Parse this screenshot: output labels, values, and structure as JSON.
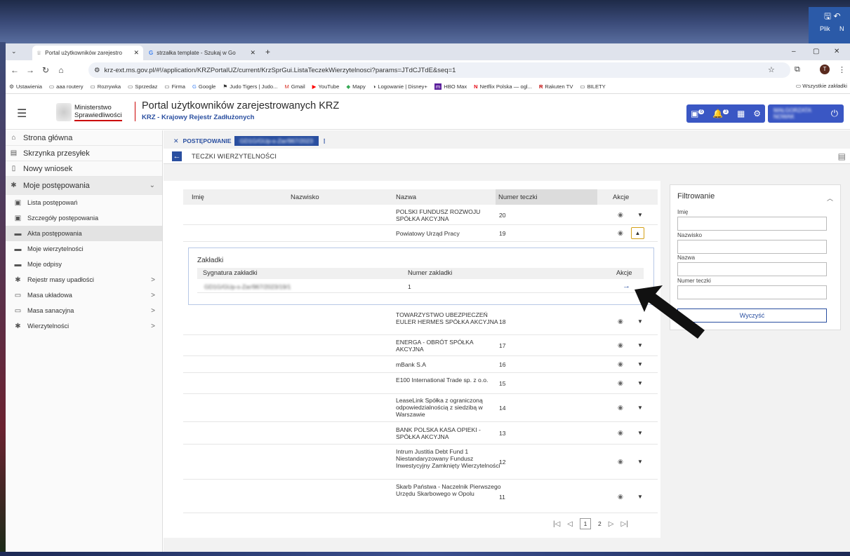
{
  "word": {
    "label_plik": "Plik",
    "label_n": "N"
  },
  "browser": {
    "tabs": [
      {
        "label": "Portal użytkowników zarejestro",
        "close": "✕"
      },
      {
        "label": "strzałka template - Szukaj w Go",
        "close": "✕"
      }
    ],
    "new_tab": "+",
    "url": "krz-ext.ms.gov.pl/#!/application/KRZPortalUZ/current/KrzSprGui.ListaTeczekWierzytelnosci?params=JTdCJTdE&seq=1",
    "window_controls": {
      "min": "–",
      "max": "▢",
      "close": "✕"
    },
    "bookmarks": [
      "Ustawienia",
      "aaa routery",
      "Rozrywka",
      "Sprzedaz",
      "Firma",
      "Google",
      "Judo Tigers | Judo...",
      "Gmail",
      "YouTube",
      "Mapy",
      "Logowanie | Disney+",
      "HBO Max",
      "Netflix Polska — ogl...",
      "Rakuten TV",
      "BILETY"
    ],
    "bookmarks_all": "Wszystkie zakładki",
    "profile_initial": "T"
  },
  "header": {
    "logo_line1": "Ministerstwo",
    "logo_line2": "Sprawiedliwości",
    "title": "Portal użytkowników zarejestrowanych KRZ",
    "subtitle": "KRZ - Krajowy Rejestr Zadłużonych",
    "badge_messages": "6",
    "badge_notifications": "3",
    "user_name": "MAŁGORZATA NOWAK"
  },
  "sidebar": {
    "items": [
      {
        "label": "Strona główna",
        "icon": "home-icon"
      },
      {
        "label": "Skrzynka przesyłek",
        "icon": "inbox-icon"
      },
      {
        "label": "Nowy wniosek",
        "icon": "document-icon"
      },
      {
        "label": "Moje postępowania",
        "icon": "gear-icon"
      }
    ],
    "subitems": [
      {
        "label": "Lista postępowań",
        "chev": ""
      },
      {
        "label": "Szczegóły postępowania",
        "chev": ""
      },
      {
        "label": "Akta postępowania",
        "chev": ""
      },
      {
        "label": "Moje wierzytelności",
        "chev": ""
      },
      {
        "label": "Moje odpisy",
        "chev": ""
      },
      {
        "label": "Rejestr masy upadłości",
        "chev": ">"
      },
      {
        "label": "Masa układowa",
        "chev": ">"
      },
      {
        "label": "Masa sanacyjna",
        "chev": ">"
      },
      {
        "label": "Wierzytelności",
        "chev": ">"
      }
    ]
  },
  "breadcrumb": {
    "close": "✕",
    "item1": "POSTĘPOWANIE",
    "item2": "GD1G/GUp-s-Zar/967/2023",
    "more": "⋮"
  },
  "page_title": "TECZKI WIERZYTELNOŚCI",
  "table": {
    "headers": [
      "Imię",
      "Nazwisko",
      "Nazwa",
      "Numer teczki",
      "Akcje"
    ],
    "rows_top": [
      {
        "name": "POLSKI FUNDUSZ ROZWOJU SPÓŁKA AKCYJNA",
        "num": "20"
      },
      {
        "name": "Powiatowy Urząd Pracy",
        "num": "19"
      }
    ],
    "rows_bottom": [
      {
        "name": "TOWARZYSTWO UBEZPIECZEŃ EULER HERMES SPÓŁKA AKCYJNA",
        "num": "18"
      },
      {
        "name": "ENERGA - OBRÓT SPÓŁKA AKCYJNA",
        "num": "17"
      },
      {
        "name": "mBank S.A",
        "num": "16"
      },
      {
        "name": "E100 International Trade sp. z o.o.",
        "num": "15"
      },
      {
        "name": "LeaseLink Spółka z ograniczoną odpowiedzialnością z siedzibą w Warszawie",
        "num": "14"
      },
      {
        "name": "BANK POLSKA KASA OPIEKI - SPÓŁKA AKCYJNA",
        "num": "13"
      },
      {
        "name": "Intrum Justitia Debt Fund 1 Niestandaryzowany Fundusz Inwestycyjny Zamknięty Wierzytelności",
        "num": "12"
      },
      {
        "name": "Skarb Państwa - Naczelnik Pierwszego Urzędu Skarbowego w Opolu",
        "num": "11"
      }
    ]
  },
  "zakladki": {
    "title": "Zakładki",
    "headers": [
      "Sygnatura zakładki",
      "Numer zakladki",
      "Akcje"
    ],
    "row": {
      "sygnatura": "GD1G/GUp-s-Zar/967/2023/19/1",
      "numer": "1",
      "action": "→"
    }
  },
  "pager": {
    "first": "|◁",
    "prev": "◁",
    "page1": "1",
    "page2": "2",
    "next": "▷",
    "last": "▷|"
  },
  "filter": {
    "title": "Filtrowanie",
    "labels": [
      "Imię",
      "Nazwisko",
      "Nazwa",
      "Numer teczki"
    ],
    "clear_button": "Wyczyść"
  },
  "colors": {
    "primary": "#2a4fa0",
    "header_button": "#3a57c4",
    "accent_border": "#d4a017"
  }
}
